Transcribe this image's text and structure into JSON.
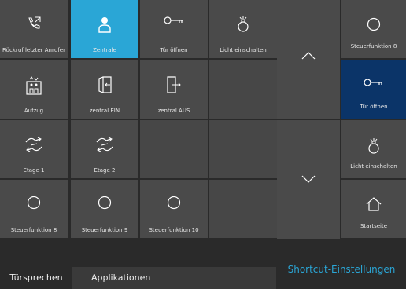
{
  "grid": [
    {
      "label": "Rückruf letzter Anrufer",
      "icon": "phone-callback-icon",
      "state": "normal"
    },
    {
      "label": "Zentrale",
      "icon": "person-icon",
      "state": "active"
    },
    {
      "label": "Tür öffnen",
      "icon": "key-icon",
      "state": "normal"
    },
    {
      "label": "Licht einschalten",
      "icon": "light-bulb-icon",
      "state": "normal"
    },
    {
      "label": "Aufzug",
      "icon": "elevator-icon",
      "state": "normal"
    },
    {
      "label": "zentral EIN",
      "icon": "door-enter-icon",
      "state": "normal"
    },
    {
      "label": "zentral AUS",
      "icon": "door-exit-icon",
      "state": "normal"
    },
    {
      "label": "",
      "icon": "",
      "state": "empty"
    },
    {
      "label": "Etage 1",
      "icon": "switch-arrows-icon",
      "state": "normal"
    },
    {
      "label": "Etage 2",
      "icon": "switch-arrows-icon",
      "state": "normal"
    },
    {
      "label": "",
      "icon": "",
      "state": "empty"
    },
    {
      "label": "",
      "icon": "",
      "state": "empty"
    },
    {
      "label": "Steuerfunktion 8",
      "icon": "circle-icon",
      "state": "normal"
    },
    {
      "label": "Steuerfunktion 9",
      "icon": "circle-icon",
      "state": "normal"
    },
    {
      "label": "Steuerfunktion 10",
      "icon": "circle-icon",
      "state": "normal"
    },
    {
      "label": "",
      "icon": "",
      "state": "empty"
    }
  ],
  "shortcuts": [
    {
      "label": "Steuerfunktion 8",
      "icon": "circle-icon",
      "selected": false
    },
    {
      "label": "Tür öffnen",
      "icon": "key-icon",
      "selected": true
    },
    {
      "label": "Licht einschalten",
      "icon": "light-bulb-icon",
      "selected": false
    },
    {
      "label": "Startseite",
      "icon": "home-icon",
      "selected": false
    }
  ],
  "bottom": {
    "tab_door": "Türsprechen",
    "tab_apps": "Applikationen",
    "shortcut_settings": "Shortcut-Einstellungen"
  },
  "colors": {
    "accent": "#2aa6d6",
    "selected": "#0b3468",
    "tile": "#4a4a4a"
  }
}
